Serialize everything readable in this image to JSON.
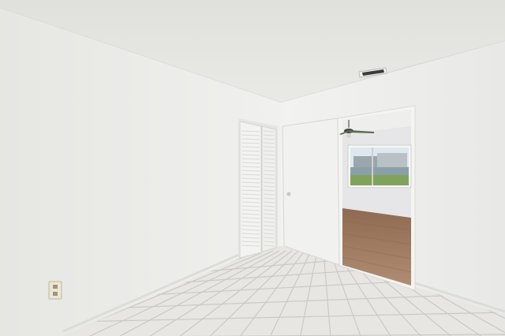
{
  "scene": {
    "description_label": "",
    "colors": {
      "ceiling": "#e4e4e1",
      "left_wall": "#ececea",
      "back_wall": "#f0f0ee",
      "right_wall": "#eeeeec",
      "floor_tile": "#e7e6e3",
      "grout": "#cfcdc8",
      "wood_floor": "#a07b62",
      "closet_door": "#f3f3f1",
      "door": "#f1f1ef",
      "lawn": "#7fa35b",
      "sky": "#dfe7ee"
    },
    "icons": [
      "air-vent-icon",
      "ceiling-fan-icon",
      "electrical-outlet-icon",
      "door-knob-icon"
    ]
  }
}
